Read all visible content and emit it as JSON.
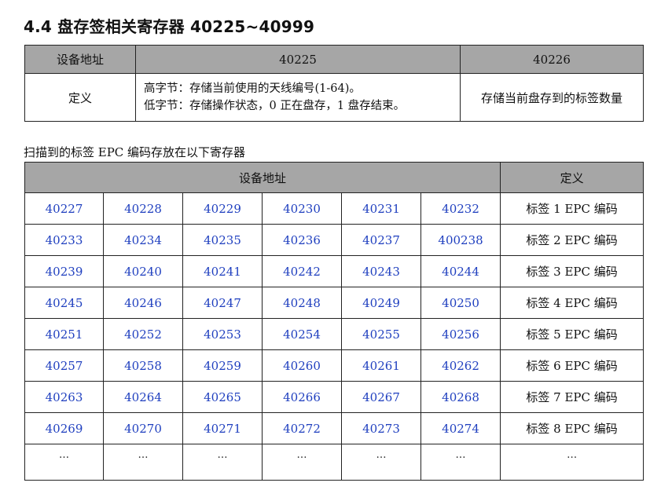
{
  "section": {
    "title": "4.4 盘存签相关寄存器 40225~40999"
  },
  "table1": {
    "headers": [
      "设备地址",
      "40225",
      "40226"
    ],
    "row": {
      "label": "定义",
      "desc_line1": "高字节：存储当前使用的天线编号(1-64)。",
      "desc_line2": "低字节：存储操作状态，0 正在盘存，1 盘存结束。",
      "desc_right": "存储当前盘存到的标签数量"
    }
  },
  "caption": "扫描到的标签 EPC 编码存放在以下寄存器",
  "table2": {
    "header_address": "设备地址",
    "header_definition": "定义",
    "rows": [
      {
        "cells": [
          "40227",
          "40228",
          "40229",
          "40230",
          "40231",
          "40232"
        ],
        "definition": "标签 1 EPC 编码"
      },
      {
        "cells": [
          "40233",
          "40234",
          "40235",
          "40236",
          "40237",
          "400238"
        ],
        "definition": "标签 2 EPC 编码"
      },
      {
        "cells": [
          "40239",
          "40240",
          "40241",
          "40242",
          "40243",
          "40244"
        ],
        "definition": "标签 3 EPC 编码"
      },
      {
        "cells": [
          "40245",
          "40246",
          "40247",
          "40248",
          "40249",
          "40250"
        ],
        "definition": "标签 4 EPC 编码"
      },
      {
        "cells": [
          "40251",
          "40252",
          "40253",
          "40254",
          "40255",
          "40256"
        ],
        "definition": "标签 5 EPC 编码"
      },
      {
        "cells": [
          "40257",
          "40258",
          "40259",
          "40260",
          "40261",
          "40262"
        ],
        "definition": "标签 6 EPC 编码"
      },
      {
        "cells": [
          "40263",
          "40264",
          "40265",
          "40266",
          "40267",
          "40268"
        ],
        "definition": "标签 7 EPC 编码"
      },
      {
        "cells": [
          "40269",
          "40270",
          "40271",
          "40272",
          "40273",
          "40274"
        ],
        "definition": "标签 8 EPC 编码"
      },
      {
        "cells": [
          "…",
          "…",
          "…",
          "…",
          "…",
          "…"
        ],
        "definition": "…"
      }
    ]
  },
  "colors": {
    "header_bg": "#a6a6a6",
    "address_text": "#1f3fbf",
    "border": "#222222"
  }
}
